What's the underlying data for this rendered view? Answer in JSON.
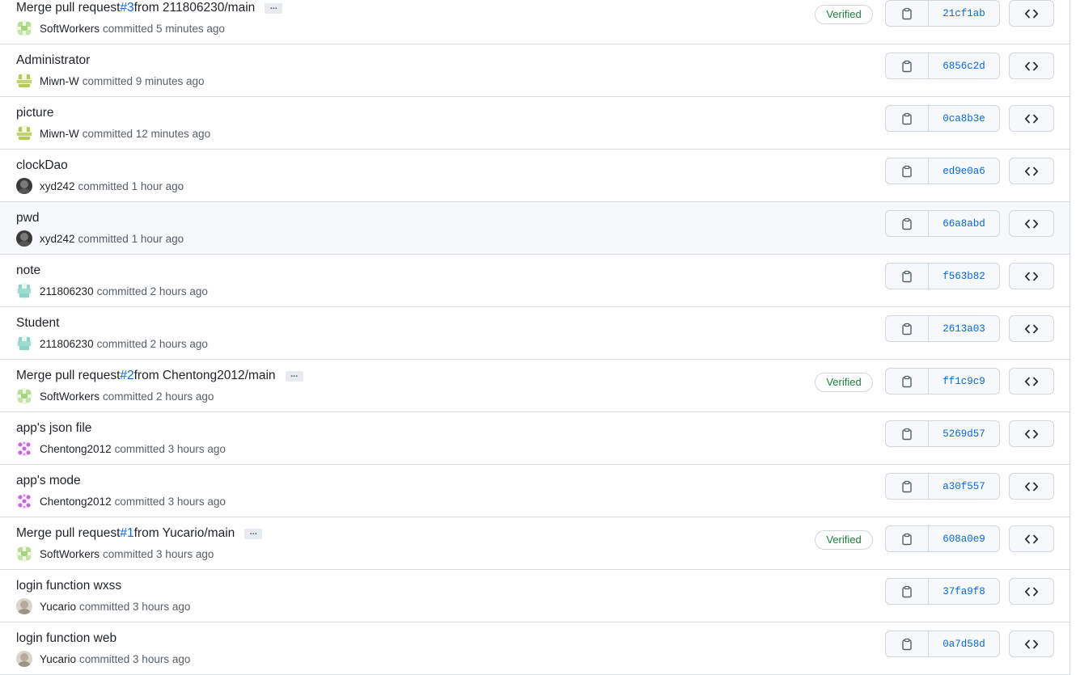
{
  "commits": [
    {
      "title": "Merge pull request ",
      "pr": "#3",
      "title_after": " from 211806230/main",
      "has_ellipsis": true,
      "ellipsis_label": "...",
      "author": "SoftWorkers",
      "avatar": "softworkers",
      "time": "committed 5 minutes ago",
      "verified": true,
      "verified_label": "Verified",
      "sha": "21cf1ab"
    },
    {
      "title": "Administrator",
      "author": "Miwn-W",
      "avatar": "miwn",
      "time": "committed 9 minutes ago",
      "sha": "6856c2d"
    },
    {
      "title": "picture",
      "author": "Miwn-W",
      "avatar": "miwn",
      "time": "committed 12 minutes ago",
      "sha": "0ca8b3e"
    },
    {
      "title": "clockDao",
      "author": "xyd242",
      "avatar": "xyd",
      "time": "committed 1 hour ago",
      "sha": "ed9e0a6"
    },
    {
      "title": "pwd",
      "author": "xyd242",
      "avatar": "xyd",
      "time": "committed 1 hour ago",
      "sha": "66a8abd",
      "hover": true
    },
    {
      "title": "note",
      "author": "211806230",
      "avatar": "u211",
      "time": "committed 2 hours ago",
      "sha": "f563b82"
    },
    {
      "title": "Student",
      "author": "211806230",
      "avatar": "u211",
      "time": "committed 2 hours ago",
      "sha": "2613a03"
    },
    {
      "title": "Merge pull request ",
      "pr": "#2",
      "title_after": " from Chentong2012/main",
      "has_ellipsis": true,
      "ellipsis_label": "...",
      "author": "SoftWorkers",
      "avatar": "softworkers",
      "time": "committed 2 hours ago",
      "verified": true,
      "verified_label": "Verified",
      "sha": "ff1c9c9"
    },
    {
      "title": "app's json file",
      "author": "Chentong2012",
      "avatar": "chentong",
      "time": "committed 3 hours ago",
      "sha": "5269d57"
    },
    {
      "title": "app's mode",
      "author": "Chentong2012",
      "avatar": "chentong",
      "time": "committed 3 hours ago",
      "sha": "a30f557"
    },
    {
      "title": "Merge pull request ",
      "pr": "#1",
      "title_after": " from Yucario/main",
      "has_ellipsis": true,
      "ellipsis_label": "...",
      "author": "SoftWorkers",
      "avatar": "softworkers",
      "time": "committed 3 hours ago",
      "verified": true,
      "verified_label": "Verified",
      "sha": "608a0e9"
    },
    {
      "title": "login function wxss",
      "author": "Yucario",
      "avatar": "yucario",
      "time": "committed 3 hours ago",
      "sha": "37fa9f8"
    },
    {
      "title": "login function web",
      "author": "Yucario",
      "avatar": "yucario",
      "time": "committed 3 hours ago",
      "sha": "0a7d58d"
    }
  ],
  "colors": {
    "link": "#0969da",
    "verified": "#1a7f37",
    "border": "#d0d7de",
    "button_bg": "#f6f8fa"
  },
  "icons": {
    "copy": "clipboard-icon",
    "browse": "code-icon"
  }
}
